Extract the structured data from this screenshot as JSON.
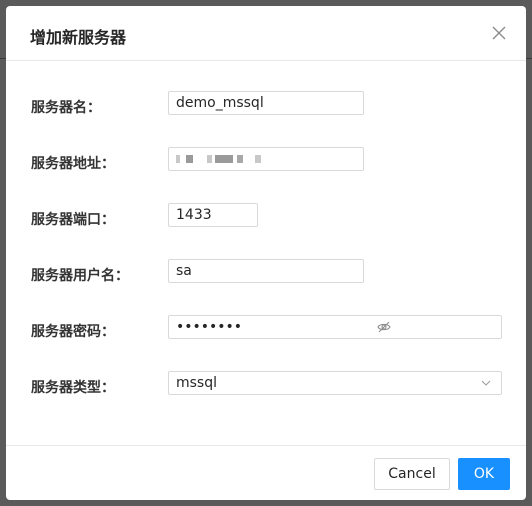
{
  "dialog": {
    "title": "增加新服务器"
  },
  "form": {
    "server_name": {
      "label": "服务器名：",
      "value": "demo_mssql"
    },
    "server_address": {
      "label": "服务器地址：",
      "value": ""
    },
    "server_port": {
      "label": "服务器端口：",
      "value": "1433"
    },
    "server_user": {
      "label": "服务器用户名：",
      "value": "sa"
    },
    "server_password": {
      "label": "服务器密码：",
      "value": "••••••••"
    },
    "server_type": {
      "label": "服务器类型：",
      "value": "mssql"
    }
  },
  "footer": {
    "cancel_label": "Cancel",
    "ok_label": "OK"
  },
  "colors": {
    "primary": "#1890ff",
    "border": "#d9d9d9"
  },
  "icons": [
    "close-icon",
    "eye-invisible-icon",
    "chevron-down-icon"
  ]
}
